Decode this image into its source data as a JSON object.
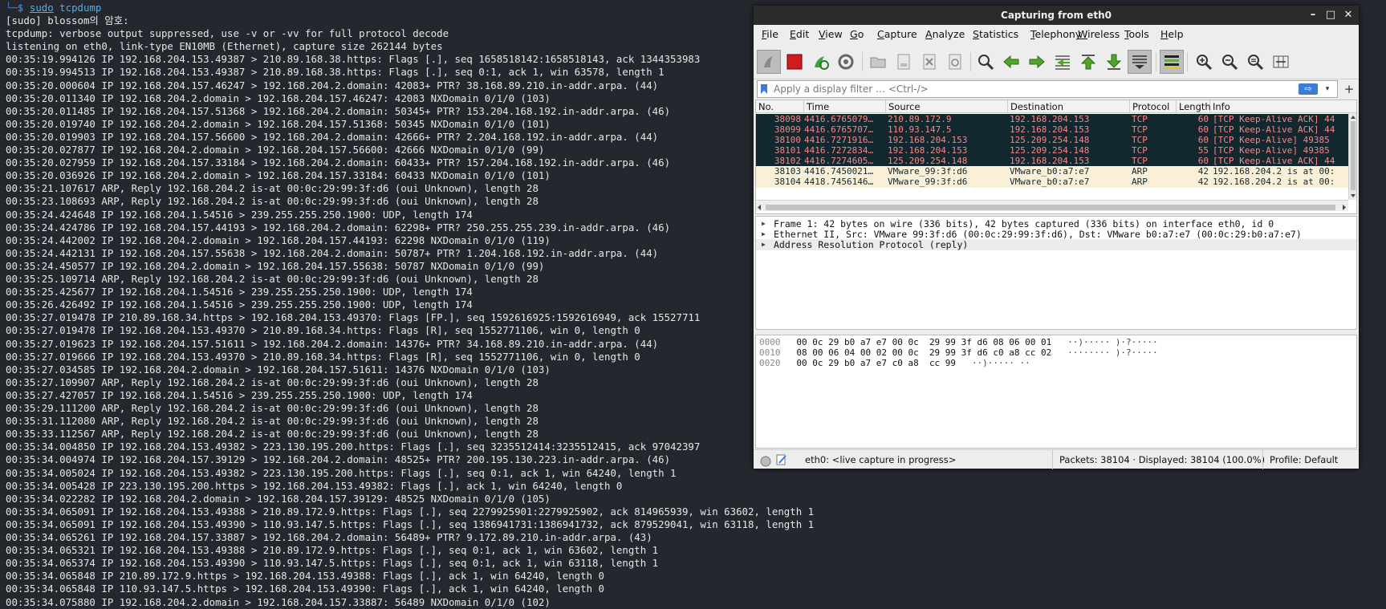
{
  "terminal": {
    "prompt_arrow": "└─",
    "prompt_symbol": "$",
    "cmd_sudo": "sudo",
    "cmd_name": "tcpdump",
    "lines": [
      "[sudo] blossom의 암호:",
      "tcpdump: verbose output suppressed, use -v or -vv for full protocol decode",
      "listening on eth0, link-type EN10MB (Ethernet), capture size 262144 bytes",
      "00:35:19.994126 IP 192.168.204.153.49387 > 210.89.168.38.https: Flags [.], seq 1658518142:1658518143, ack 1344353983",
      "00:35:19.994513 IP 192.168.204.153.49387 > 210.89.168.38.https: Flags [.], seq 0:1, ack 1, win 63578, length 1",
      "00:35:20.000604 IP 192.168.204.157.46247 > 192.168.204.2.domain: 42083+ PTR? 38.168.89.210.in-addr.arpa. (44)",
      "00:35:20.011340 IP 192.168.204.2.domain > 192.168.204.157.46247: 42083 NXDomain 0/1/0 (103)",
      "00:35:20.011485 IP 192.168.204.157.51368 > 192.168.204.2.domain: 50345+ PTR? 153.204.168.192.in-addr.arpa. (46)",
      "00:35:20.019740 IP 192.168.204.2.domain > 192.168.204.157.51368: 50345 NXDomain 0/1/0 (101)",
      "00:35:20.019903 IP 192.168.204.157.56600 > 192.168.204.2.domain: 42666+ PTR? 2.204.168.192.in-addr.arpa. (44)",
      "00:35:20.027877 IP 192.168.204.2.domain > 192.168.204.157.56600: 42666 NXDomain 0/1/0 (99)",
      "00:35:20.027959 IP 192.168.204.157.33184 > 192.168.204.2.domain: 60433+ PTR? 157.204.168.192.in-addr.arpa. (46)",
      "00:35:20.036926 IP 192.168.204.2.domain > 192.168.204.157.33184: 60433 NXDomain 0/1/0 (101)",
      "00:35:21.107617 ARP, Reply 192.168.204.2 is-at 00:0c:29:99:3f:d6 (oui Unknown), length 28",
      "00:35:23.108693 ARP, Reply 192.168.204.2 is-at 00:0c:29:99:3f:d6 (oui Unknown), length 28",
      "00:35:24.424648 IP 192.168.204.1.54516 > 239.255.255.250.1900: UDP, length 174",
      "00:35:24.424786 IP 192.168.204.157.44193 > 192.168.204.2.domain: 62298+ PTR? 250.255.255.239.in-addr.arpa. (46)",
      "00:35:24.442002 IP 192.168.204.2.domain > 192.168.204.157.44193: 62298 NXDomain 0/1/0 (119)",
      "00:35:24.442131 IP 192.168.204.157.55638 > 192.168.204.2.domain: 50787+ PTR? 1.204.168.192.in-addr.arpa. (44)",
      "00:35:24.450577 IP 192.168.204.2.domain > 192.168.204.157.55638: 50787 NXDomain 0/1/0 (99)",
      "00:35:25.109714 ARP, Reply 192.168.204.2 is-at 00:0c:29:99:3f:d6 (oui Unknown), length 28",
      "00:35:25.425677 IP 192.168.204.1.54516 > 239.255.255.250.1900: UDP, length 174",
      "00:35:26.426492 IP 192.168.204.1.54516 > 239.255.255.250.1900: UDP, length 174",
      "00:35:27.019478 IP 210.89.168.34.https > 192.168.204.153.49370: Flags [FP.], seq 1592616925:1592616949, ack 15527711",
      "00:35:27.019478 IP 192.168.204.153.49370 > 210.89.168.34.https: Flags [R], seq 1552771106, win 0, length 0",
      "00:35:27.019623 IP 192.168.204.157.51611 > 192.168.204.2.domain: 14376+ PTR? 34.168.89.210.in-addr.arpa. (44)",
      "00:35:27.019666 IP 192.168.204.153.49370 > 210.89.168.34.https: Flags [R], seq 1552771106, win 0, length 0",
      "00:35:27.034585 IP 192.168.204.2.domain > 192.168.204.157.51611: 14376 NXDomain 0/1/0 (103)",
      "00:35:27.109907 ARP, Reply 192.168.204.2 is-at 00:0c:29:99:3f:d6 (oui Unknown), length 28",
      "00:35:27.427057 IP 192.168.204.1.54516 > 239.255.255.250.1900: UDP, length 174",
      "00:35:29.111200 ARP, Reply 192.168.204.2 is-at 00:0c:29:99:3f:d6 (oui Unknown), length 28",
      "00:35:31.112080 ARP, Reply 192.168.204.2 is-at 00:0c:29:99:3f:d6 (oui Unknown), length 28",
      "00:35:33.112567 ARP, Reply 192.168.204.2 is-at 00:0c:29:99:3f:d6 (oui Unknown), length 28",
      "00:35:34.004850 IP 192.168.204.153.49382 > 223.130.195.200.https: Flags [.], seq 3235512414:3235512415, ack 97042397",
      "00:35:34.004974 IP 192.168.204.157.39129 > 192.168.204.2.domain: 48525+ PTR? 200.195.130.223.in-addr.arpa. (46)",
      "00:35:34.005024 IP 192.168.204.153.49382 > 223.130.195.200.https: Flags [.], seq 0:1, ack 1, win 64240, length 1",
      "00:35:34.005428 IP 223.130.195.200.https > 192.168.204.153.49382: Flags [.], ack 1, win 64240, length 0",
      "00:35:34.022282 IP 192.168.204.2.domain > 192.168.204.157.39129: 48525 NXDomain 0/1/0 (105)",
      "00:35:34.065091 IP 192.168.204.153.49388 > 210.89.172.9.https: Flags [.], seq 2279925901:2279925902, ack 814965939, win 63602, length 1",
      "00:35:34.065091 IP 192.168.204.153.49390 > 110.93.147.5.https: Flags [.], seq 1386941731:1386941732, ack 879529041, win 63118, length 1",
      "00:35:34.065261 IP 192.168.204.157.33887 > 192.168.204.2.domain: 56489+ PTR? 9.172.89.210.in-addr.arpa. (43)",
      "00:35:34.065321 IP 192.168.204.153.49388 > 210.89.172.9.https: Flags [.], seq 0:1, ack 1, win 63602, length 1",
      "00:35:34.065374 IP 192.168.204.153.49390 > 110.93.147.5.https: Flags [.], seq 0:1, ack 1, win 63118, length 1",
      "00:35:34.065848 IP 210.89.172.9.https > 192.168.204.153.49388: Flags [.], ack 1, win 64240, length 0",
      "00:35:34.065848 IP 110.93.147.5.https > 192.168.204.153.49390: Flags [.], ack 1, win 64240, length 0",
      "00:35:34.075880 IP 192.168.204.2.domain > 192.168.204.157.33887: 56489 NXDomain 0/1/0 (102)"
    ]
  },
  "wireshark": {
    "title": "Capturing from eth0",
    "window_buttons": [
      "–",
      "□",
      "✕"
    ],
    "menu": [
      "File",
      "Edit",
      "View",
      "Go",
      "Capture",
      "Analyze",
      "Statistics",
      "Telephony",
      "Wireless",
      "Tools",
      "Help"
    ],
    "toolbar_icons": [
      "shark-fin-start-icon",
      "stop-capture-icon",
      "restart-capture-icon",
      "capture-options-icon",
      "open-file-icon",
      "save-file-icon",
      "close-file-icon",
      "reload-file-icon",
      "find-packet-icon",
      "go-back-icon",
      "go-forward-icon",
      "go-to-packet-icon",
      "go-first-icon",
      "go-last-icon",
      "auto-scroll-icon",
      "colorize-icon",
      "zoom-in-icon",
      "zoom-out-icon",
      "normal-size-icon",
      "resize-columns-icon"
    ],
    "filter": {
      "placeholder": "Apply a display filter … <Ctrl-/>",
      "apply_label": "⇨",
      "dropdown_label": "▾",
      "add_label": "+"
    },
    "columns": [
      "No.",
      "Time",
      "Source",
      "Destination",
      "Protocol",
      "Length",
      "Info"
    ],
    "packets": [
      {
        "no": "38098",
        "time": "4416.6765079…",
        "src": "210.89.172.9",
        "dst": "192.168.204.153",
        "proto": "TCP",
        "len": "60",
        "info": "[TCP Keep-Alive ACK] 44",
        "kind": "tcp"
      },
      {
        "no": "38099",
        "time": "4416.6765707…",
        "src": "110.93.147.5",
        "dst": "192.168.204.153",
        "proto": "TCP",
        "len": "60",
        "info": "[TCP Keep-Alive ACK] 44",
        "kind": "tcp"
      },
      {
        "no": "38100",
        "time": "4416.7271916…",
        "src": "192.168.204.153",
        "dst": "125.209.254.148",
        "proto": "TCP",
        "len": "60",
        "info": "[TCP Keep-Alive] 49385",
        "kind": "tcp"
      },
      {
        "no": "38101",
        "time": "4416.7272834…",
        "src": "192.168.204.153",
        "dst": "125.209.254.148",
        "proto": "TCP",
        "len": "55",
        "info": "[TCP Keep-Alive] 49385",
        "kind": "tcp"
      },
      {
        "no": "38102",
        "time": "4416.7274605…",
        "src": "125.209.254.148",
        "dst": "192.168.204.153",
        "proto": "TCP",
        "len": "60",
        "info": "[TCP Keep-Alive ACK] 44",
        "kind": "tcp"
      },
      {
        "no": "38103",
        "time": "4416.7450021…",
        "src": "VMware_99:3f:d6",
        "dst": "VMware_b0:a7:e7",
        "proto": "ARP",
        "len": "42",
        "info": "192.168.204.2 is at 00:",
        "kind": "arp"
      },
      {
        "no": "38104",
        "time": "4418.7456146…",
        "src": "VMware_99:3f:d6",
        "dst": "VMware_b0:a7:e7",
        "proto": "ARP",
        "len": "42",
        "info": "192.168.204.2 is at 00:",
        "kind": "arp"
      }
    ],
    "details": [
      "Frame 1: 42 bytes on wire (336 bits), 42 bytes captured (336 bits) on interface eth0, id 0",
      "Ethernet II, Src: VMware_99:3f:d6 (00:0c:29:99:3f:d6), Dst: VMware_b0:a7:e7 (00:0c:29:b0:a7:e7)",
      "Address Resolution Protocol (reply)"
    ],
    "hex": [
      {
        "off": "0000",
        "bytes": "00 0c 29 b0 a7 e7 00 0c  29 99 3f d6 08 06 00 01",
        "ascii": "··)····· )·?·····"
      },
      {
        "off": "0010",
        "bytes": "08 00 06 04 00 02 00 0c  29 99 3f d6 c0 a8 cc 02",
        "ascii": "········ )·?·····"
      },
      {
        "off": "0020",
        "bytes": "00 0c 29 b0 a7 e7 c0 a8  cc 99",
        "ascii": "··)····· ··"
      }
    ],
    "status": {
      "interface": "eth0: <live capture in progress>",
      "packets": "Packets: 38104 · Displayed: 38104 (100.0%)",
      "profile": "Profile: Default"
    },
    "colors": {
      "tcp_row_bg": "#12272e",
      "tcp_row_fg": "#f78787",
      "arp_row_bg": "#faf0d7",
      "arp_row_fg": "#12272e"
    }
  }
}
